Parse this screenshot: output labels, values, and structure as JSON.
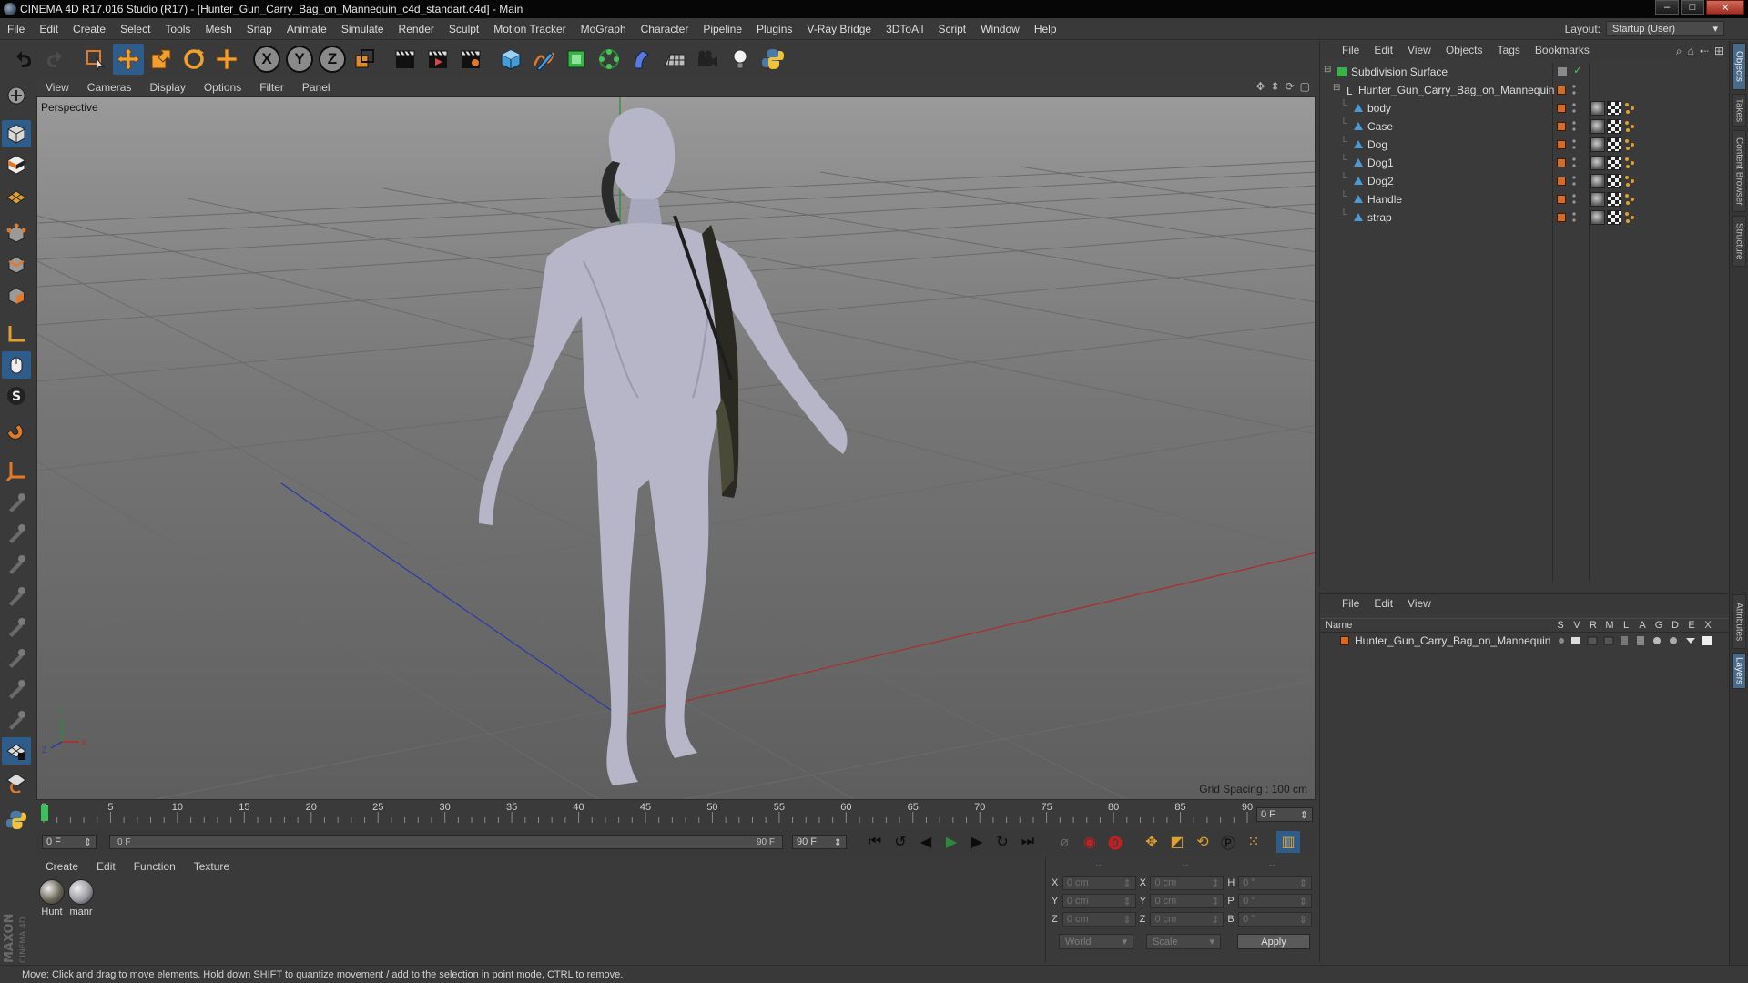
{
  "window": {
    "title": "CINEMA 4D R17.016 Studio (R17) - [Hunter_Gun_Carry_Bag_on_Mannequin_c4d_standart.c4d] - Main",
    "controls": [
      "–",
      "□",
      "✕"
    ]
  },
  "menubar": {
    "items": [
      "File",
      "Edit",
      "Create",
      "Select",
      "Tools",
      "Mesh",
      "Snap",
      "Animate",
      "Simulate",
      "Render",
      "Sculpt",
      "Motion Tracker",
      "MoGraph",
      "Character",
      "Pipeline",
      "Plugins",
      "V-Ray Bridge",
      "3DToAll",
      "Script",
      "Window",
      "Help"
    ],
    "layout_label": "Layout:",
    "layout_value": "Startup (User)"
  },
  "toolbar": {
    "axis_x": "X",
    "axis_y": "Y",
    "axis_z": "Z"
  },
  "viewport": {
    "menu": [
      "View",
      "Cameras",
      "Display",
      "Options",
      "Filter",
      "Panel"
    ],
    "label": "Perspective",
    "grid_spacing": "Grid Spacing : 100 cm",
    "axis_y": "Y",
    "axis_z": "Z",
    "axis_x": "X"
  },
  "timeline": {
    "ticks": [
      "0",
      "5",
      "10",
      "15",
      "20",
      "25",
      "30",
      "35",
      "40",
      "45",
      "50",
      "55",
      "60",
      "65",
      "70",
      "75",
      "80",
      "85",
      "90"
    ],
    "current_frame": "0 F",
    "start_frame": "0 F",
    "range_start": "0 F",
    "range_end": "90 F",
    "end_frame": "90 F"
  },
  "materials": {
    "menu": [
      "Create",
      "Edit",
      "Function",
      "Texture"
    ],
    "items": [
      {
        "name": "Hunt",
        "color": "#6a6658"
      },
      {
        "name": "manr",
        "color": "#9a9aa2"
      }
    ]
  },
  "coordinates": {
    "header": [
      "--",
      "--",
      "--"
    ],
    "rows": [
      {
        "a1": "X",
        "v1": "0 cm",
        "a2": "X",
        "v2": "0 cm",
        "a3": "H",
        "v3": "0 °"
      },
      {
        "a1": "Y",
        "v1": "0 cm",
        "a2": "Y",
        "v2": "0 cm",
        "a3": "P",
        "v3": "0 °"
      },
      {
        "a1": "Z",
        "v1": "0 cm",
        "a2": "Z",
        "v2": "0 cm",
        "a3": "B",
        "v3": "0 °"
      }
    ],
    "space": "World",
    "mode": "Scale",
    "apply": "Apply"
  },
  "objects": {
    "menu": [
      "File",
      "Edit",
      "View",
      "Objects",
      "Tags",
      "Bookmarks"
    ],
    "root": "Subdivision Surface",
    "group": "Hunter_Gun_Carry_Bag_on_Mannequin",
    "children": [
      "body",
      "Case",
      "Dog",
      "Dog1",
      "Dog2",
      "Handle",
      "strap"
    ]
  },
  "layers": {
    "menu": [
      "File",
      "Edit",
      "View"
    ],
    "name_header": "Name",
    "columns": [
      "S",
      "V",
      "R",
      "M",
      "L",
      "A",
      "G",
      "D",
      "E",
      "X"
    ],
    "items": [
      "Hunter_Gun_Carry_Bag_on_Mannequin"
    ]
  },
  "side_tabs": [
    "Objects",
    "Takes",
    "Content Browser",
    "Structure",
    "Attributes",
    "Layers"
  ],
  "status": "Move: Click and drag to move elements. Hold down SHIFT to quantize movement / add to the selection in point mode, CTRL to remove.",
  "colors": {
    "accent": "#2e5d8c",
    "orange": "#d46b26",
    "viewport_bg": "#7a7a7a"
  }
}
